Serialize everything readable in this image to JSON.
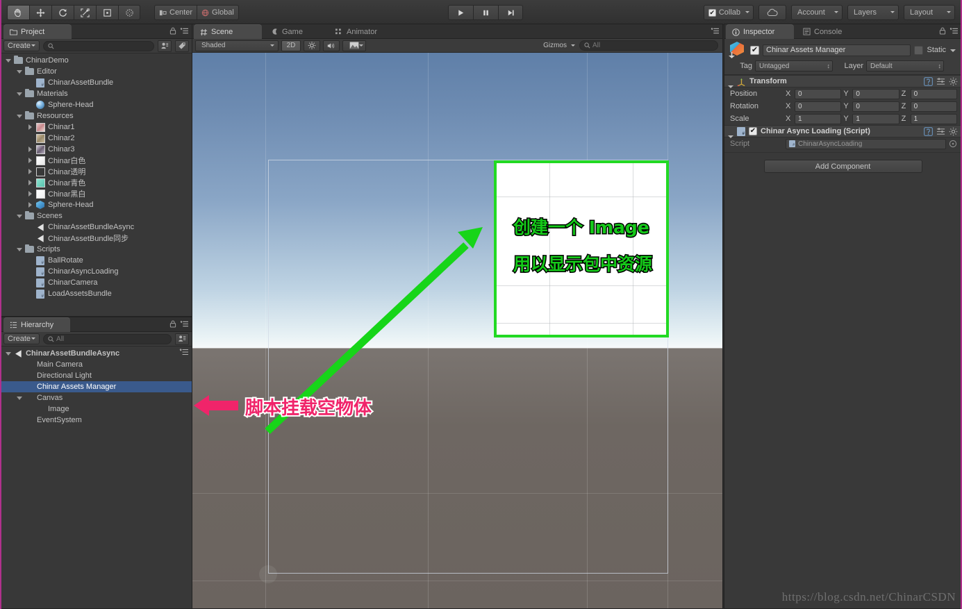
{
  "toolbar": {
    "transform_tools": [
      {
        "name": "hand-tool",
        "glyph": "✋",
        "active": true
      },
      {
        "name": "move-tool",
        "glyph": "✥",
        "active": false
      },
      {
        "name": "rotate-tool",
        "glyph": "⟳",
        "active": false
      },
      {
        "name": "scale-tool",
        "glyph": "⤢",
        "active": false
      },
      {
        "name": "rect-tool",
        "glyph": "▣",
        "active": false
      },
      {
        "name": "transform-tool",
        "glyph": "◉",
        "active": false
      }
    ],
    "pivot_mode": "Center",
    "pivot_rotation": "Global",
    "play": "▶",
    "pause": "❚❚",
    "step": "▶❙",
    "collab": "Collab",
    "cloud_icon": "cloud-icon",
    "account": "Account",
    "layers": "Layers",
    "layout": "Layout"
  },
  "project": {
    "tab": "Project",
    "create": "Create",
    "search_placeholder": "",
    "tree": [
      {
        "label": "ChinarDemo",
        "depth": 0,
        "icon": "folder",
        "arrow": "open"
      },
      {
        "label": "Editor",
        "depth": 1,
        "icon": "folder",
        "arrow": "open"
      },
      {
        "label": "ChinarAssetBundle",
        "depth": 2,
        "icon": "cs",
        "arrow": "none"
      },
      {
        "label": "Materials",
        "depth": 1,
        "icon": "folder",
        "arrow": "open"
      },
      {
        "label": "Sphere-Head",
        "depth": 2,
        "icon": "mat",
        "arrow": "none"
      },
      {
        "label": "Resources",
        "depth": 1,
        "icon": "folder",
        "arrow": "open"
      },
      {
        "label": "Chinar1",
        "depth": 2,
        "icon": "tex1",
        "arrow": "closed"
      },
      {
        "label": "Chinar2",
        "depth": 2,
        "icon": "tex2",
        "arrow": "none"
      },
      {
        "label": "Chinar3",
        "depth": 2,
        "icon": "tex3",
        "arrow": "closed"
      },
      {
        "label": "Chinar白色",
        "depth": 2,
        "icon": "tex4",
        "arrow": "closed"
      },
      {
        "label": "Chinar透明",
        "depth": 2,
        "icon": "tex5",
        "arrow": "closed"
      },
      {
        "label": "Chinar青色",
        "depth": 2,
        "icon": "tex6",
        "arrow": "closed"
      },
      {
        "label": "Chinar黑白",
        "depth": 2,
        "icon": "tex7",
        "arrow": "closed"
      },
      {
        "label": "Sphere-Head",
        "depth": 2,
        "icon": "prefab",
        "arrow": "closed"
      },
      {
        "label": "Scenes",
        "depth": 1,
        "icon": "folder",
        "arrow": "open"
      },
      {
        "label": "ChinarAssetBundleAsync",
        "depth": 2,
        "icon": "unity",
        "arrow": "none"
      },
      {
        "label": "ChinarAssetBundle同步",
        "depth": 2,
        "icon": "unity",
        "arrow": "none"
      },
      {
        "label": "Scripts",
        "depth": 1,
        "icon": "folder",
        "arrow": "open"
      },
      {
        "label": "BallRotate",
        "depth": 2,
        "icon": "cs",
        "arrow": "none"
      },
      {
        "label": "ChinarAsyncLoading",
        "depth": 2,
        "icon": "cs",
        "arrow": "none"
      },
      {
        "label": "ChinarCamera",
        "depth": 2,
        "icon": "cs",
        "arrow": "none"
      },
      {
        "label": "LoadAssetsBundle",
        "depth": 2,
        "icon": "cs",
        "arrow": "none"
      }
    ]
  },
  "hierarchy": {
    "tab": "Hierarchy",
    "create": "Create",
    "search_placeholder": "All",
    "tree": [
      {
        "label": "ChinarAssetBundleAsync",
        "depth": 0,
        "icon": "unity",
        "arrow": "open",
        "selected": false,
        "bold": true
      },
      {
        "label": "Main Camera",
        "depth": 1,
        "icon": "none",
        "arrow": "none",
        "selected": false,
        "bold": false
      },
      {
        "label": "Directional Light",
        "depth": 1,
        "icon": "none",
        "arrow": "none",
        "selected": false,
        "bold": false
      },
      {
        "label": "Chinar Assets Manager",
        "depth": 1,
        "icon": "none",
        "arrow": "none",
        "selected": true,
        "bold": false
      },
      {
        "label": "Canvas",
        "depth": 1,
        "icon": "none",
        "arrow": "open",
        "selected": false,
        "bold": false
      },
      {
        "label": "Image",
        "depth": 2,
        "icon": "none",
        "arrow": "none",
        "selected": false,
        "bold": false
      },
      {
        "label": "EventSystem",
        "depth": 1,
        "icon": "none",
        "arrow": "none",
        "selected": false,
        "bold": false
      }
    ]
  },
  "scene": {
    "tabs": [
      {
        "label": "Scene",
        "icon": "grid-icon",
        "active": true
      },
      {
        "label": "Game",
        "icon": "gamepad-icon",
        "active": false
      },
      {
        "label": "Animator",
        "icon": "animator-icon",
        "active": false
      }
    ],
    "draw_mode": "Shaded",
    "two_d": "2D",
    "light_icon": "sun-icon",
    "audio_icon": "speaker-icon",
    "fx_icon": "image-icon",
    "gizmos": "Gizmos",
    "search_placeholder": "All",
    "annotations": [
      {
        "name": "annotation-create-image",
        "text": "创建一个 Image",
        "color": "#15c919"
      },
      {
        "name": "annotation-show-bundle",
        "text": "用以显示包中资源",
        "color": "#15c919"
      },
      {
        "name": "annotation-script-host",
        "text": "脚本挂载空物体",
        "color": "#f0246a"
      }
    ]
  },
  "inspector": {
    "tabs": [
      {
        "label": "Inspector",
        "icon": "info-icon",
        "active": true
      },
      {
        "label": "Console",
        "icon": "console-icon",
        "active": false
      }
    ],
    "object_name": "Chinar Assets Manager",
    "enabled": true,
    "static_label": "Static",
    "static_checked": false,
    "tag_label": "Tag",
    "tag_value": "Untagged",
    "layer_label": "Layer",
    "layer_value": "Default",
    "components": [
      {
        "name": "Transform",
        "icon": "transform-icon",
        "has_checkbox": false,
        "rows": [
          {
            "label": "Position",
            "x": "0",
            "y": "0",
            "z": "0"
          },
          {
            "label": "Rotation",
            "x": "0",
            "y": "0",
            "z": "0"
          },
          {
            "label": "Scale",
            "x": "1",
            "y": "1",
            "z": "1"
          }
        ]
      },
      {
        "name": "Chinar Async Loading (Script)",
        "icon": "script-icon",
        "has_checkbox": true,
        "checked": true,
        "script_label": "Script",
        "script_value": "ChinarAsyncLoading"
      }
    ],
    "add_component": "Add Component"
  },
  "watermark": "https://blog.csdn.net/ChinarCSDN",
  "colors": {
    "selection_blue": "#3a5a8c",
    "annotation_green": "#15c919",
    "annotation_pink": "#f0246a",
    "image_border_green": "#22d923",
    "panel_bg": "#383838"
  }
}
